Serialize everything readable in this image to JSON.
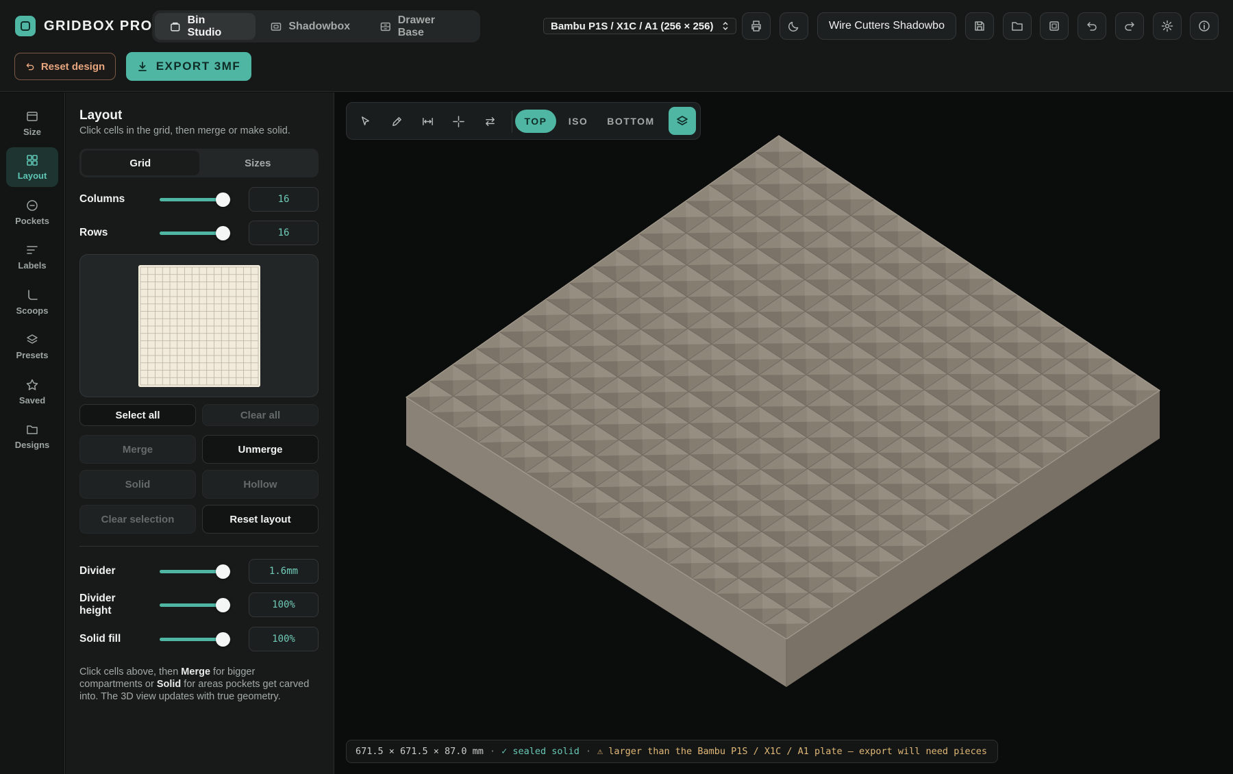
{
  "app": {
    "name": "GRIDBOX PRO"
  },
  "mode_tabs": [
    {
      "label": "Bin Studio",
      "icon": "bin-icon",
      "active": true
    },
    {
      "label": "Shadowbox",
      "icon": "shadowbox-icon",
      "active": false
    },
    {
      "label": "Drawer Base",
      "icon": "drawer-icon",
      "active": false
    }
  ],
  "printer": {
    "selected": "Bambu P1S / X1C / A1 (256 × 256)"
  },
  "design": {
    "name": "Wire Cutters Shadowbo"
  },
  "header_icons": [
    "printer-icon",
    "moon-icon",
    "save-icon",
    "folder-icon",
    "export-image-icon",
    "undo-icon",
    "redo-icon",
    "gear-icon",
    "info-icon"
  ],
  "toolbar": {
    "reset_label": "Reset design",
    "export_label": "EXPORT 3MF"
  },
  "sidenav": [
    {
      "label": "Size",
      "icon": "size-icon",
      "active": false
    },
    {
      "label": "Layout",
      "icon": "layout-grid-icon",
      "active": true
    },
    {
      "label": "Pockets",
      "icon": "pocket-icon",
      "active": false
    },
    {
      "label": "Labels",
      "icon": "label-icon",
      "active": false
    },
    {
      "label": "Scoops",
      "icon": "scoop-icon",
      "active": false
    },
    {
      "label": "Presets",
      "icon": "layers-icon",
      "active": false
    },
    {
      "label": "Saved",
      "icon": "star-icon",
      "active": false
    },
    {
      "label": "Designs",
      "icon": "folder-icon",
      "active": false
    }
  ],
  "panel": {
    "title": "Layout",
    "subtitle": "Click cells in the grid, then merge or make solid.",
    "segments": {
      "grid": "Grid",
      "sizes": "Sizes",
      "active": "grid"
    },
    "columns": {
      "label": "Columns",
      "value": "16",
      "level": 0.88
    },
    "rows": {
      "label": "Rows",
      "value": "16",
      "level": 0.88
    },
    "preview": {
      "cols": 16,
      "rows": 16
    },
    "buttons": {
      "select_all": "Select all",
      "clear_all": "Clear all",
      "merge": "Merge",
      "unmerge": "Unmerge",
      "solid": "Solid",
      "hollow": "Hollow",
      "clear_selection": "Clear selection",
      "reset_layout": "Reset layout"
    },
    "divider": {
      "label": "Divider",
      "value": "1.6mm",
      "level": 0.88
    },
    "divider_height": {
      "label": "Divider height",
      "value": "100%",
      "level": 0.88
    },
    "solid_fill": {
      "label": "Solid fill",
      "value": "100%",
      "level": 0.88
    },
    "help": {
      "p1": "Click cells above, then ",
      "b1": "Merge",
      "p2": " for bigger compartments or ",
      "b2": "Solid",
      "p3": " for areas pockets get carved into. The 3D view updates with true geometry."
    }
  },
  "view": {
    "tools": [
      "select-arrow-icon",
      "pencil-icon",
      "measure-icon",
      "crosshair-icon",
      "swap-icon"
    ],
    "views": [
      {
        "label": "TOP",
        "active": true
      },
      {
        "label": "ISO",
        "active": false
      },
      {
        "label": "BOTTOM",
        "active": false
      }
    ],
    "layers_icon": "layers-icon",
    "model": {
      "cols": 16,
      "rows": 16
    }
  },
  "status": {
    "dims": "671.5 × 671.5 × 87.0 mm",
    "sep": "·",
    "ok": "✓ sealed solid",
    "warn": "⚠ larger than the Bambu P1S / X1C / A1 plate — export will need pieces"
  },
  "colors": {
    "accent": "#4fb6a4",
    "accent_dark": "#1d3431",
    "warning_text": "#e1b876",
    "reset_text": "#e8a67f",
    "model_top": "#8b8276",
    "model_side_left": "#8a8276",
    "model_side_right": "#7a7266"
  }
}
